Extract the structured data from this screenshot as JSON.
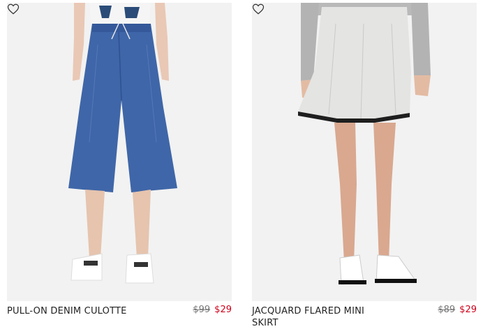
{
  "products": [
    {
      "name": "PULL-ON DENIM CULOTTE",
      "original_price": "$99",
      "sale_price": "$29",
      "favorite_icon": "heart-outline-icon"
    },
    {
      "name": "JACQUARD FLARED MINI SKIRT",
      "original_price": "$89",
      "sale_price": "$29",
      "favorite_icon": "heart-outline-icon"
    }
  ],
  "colors": {
    "sale": "#d0021b",
    "original": "#777777",
    "text": "#222222",
    "photo_bg": "#f2f2f2"
  }
}
